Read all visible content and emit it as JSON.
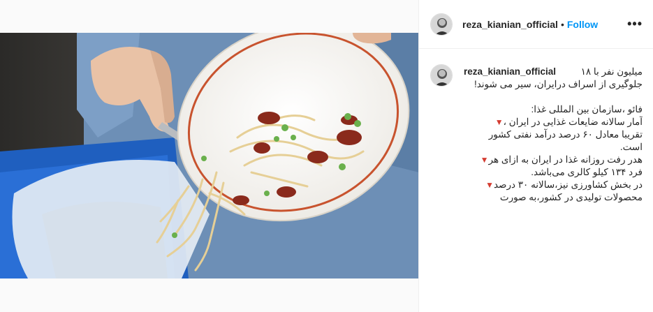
{
  "post": {
    "username": "reza_kianian_official",
    "separator": "•",
    "follow_label": "Follow",
    "more_label": "•••"
  },
  "caption": {
    "username": "reza_kianian_official",
    "lines": [
      "میلیون نفر با ۱۸",
      "جلوگیری از اسراف درایران، سیر می شوند!",
      "",
      "فائو ،سازمان بین المللی غذا:",
      "آمار سالانه ضایعات غذایی در ایران ،",
      "تقریبا معادل ۶۰ درصد درآمد نفتی کشور",
      "است.",
      "هدر رفت روزانه غذا در ایران به ازای هر",
      "فرد ۱۳۴ کیلو کالری می‌باشد.",
      "در بخش کشاورزی نیز،سالانه ۳۰ درصد",
      "محصولات تولیدی در کشور،به صورت"
    ]
  },
  "icons": {
    "bullet": "red-triangle-down-icon",
    "more": "more-options-icon"
  },
  "colors": {
    "follow": "#0095f6",
    "bullet": "#d43c31",
    "border": "#efefef"
  }
}
